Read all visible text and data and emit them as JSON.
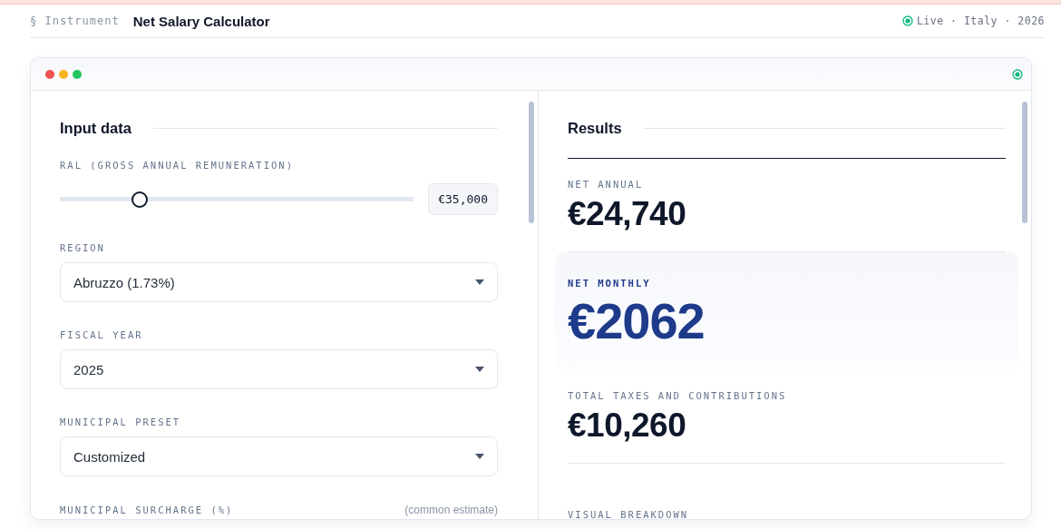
{
  "header": {
    "section": "§ Instrument",
    "title": "Net Salary Calculator",
    "status": "Live · Italy · 2026"
  },
  "input_panel": {
    "title": "Input data",
    "ral": {
      "label": "RAL (GROSS ANNUAL REMUNERATION)",
      "level": 0.226,
      "value": "€35,000"
    },
    "selects": [
      {
        "label": "REGION",
        "value": "Abruzzo (1.73%)"
      },
      {
        "label": "FISCAL YEAR",
        "value": "2025"
      },
      {
        "label": "MUNICIPAL PRESET",
        "value": "Customized"
      }
    ],
    "surcharge": {
      "label": "MUNICIPAL SURCHARGE (%)",
      "note": "(common estimate)"
    }
  },
  "results_panel": {
    "title": "Results",
    "items": [
      {
        "kind": "plain",
        "label": "NET ANNUAL",
        "value": "€24,740"
      },
      {
        "kind": "highlight",
        "label": "NET MONTHLY",
        "value": "€2062"
      },
      {
        "kind": "plain",
        "label": "TOTAL TAXES AND CONTRIBUTIONS",
        "value": "€10,260"
      }
    ],
    "breakdown_label": "VISUAL BREAKDOWN"
  }
}
